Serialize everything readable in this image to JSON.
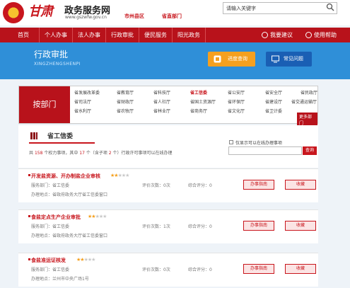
{
  "header": {
    "logo_text": "甘肃",
    "site_name": "政务服务网",
    "site_url": "www.gszwfw.gov.cn",
    "region_label": "市州县区",
    "region_label2": "省直部门",
    "search_placeholder": "请输入关键字"
  },
  "nav": {
    "items": [
      "首页",
      "个人办事",
      "法人办事",
      "行政审批",
      "便民服务",
      "阳光政务"
    ],
    "suggest": "我要建议",
    "help": "使用帮助"
  },
  "banner": {
    "title": "行政审批",
    "subtitle": "XINGZHENGSHENPI",
    "progress_btn": "进度查询",
    "faq_btn": "常见问题"
  },
  "departments": {
    "label": "按部门",
    "rows": [
      [
        "省发展改革委",
        "省教育厅",
        "省科技厅",
        "省工信委",
        "省公安厅",
        "省安全厅",
        "省民政厅"
      ],
      [
        "省司法厅",
        "省财政厅",
        "省人社厅",
        "省国土资源厅",
        "省环保厅",
        "省建设厅",
        "省交通运输厅"
      ],
      [
        "省水利厅",
        "省农牧厅",
        "省林业厅",
        "省商务厅",
        "省文化厅",
        "省卫计委",
        ""
      ]
    ],
    "active": "省工信委",
    "more": "更多部门"
  },
  "section": {
    "title": "省工信委",
    "only_online_label": "仅显示可以在线办理事项",
    "filter_btn": "查询",
    "summary_parts": [
      "共",
      "158",
      "个权力事项，其中",
      "17",
      "个（含子项",
      "2",
      "个）行政许可事项可以在线办理"
    ]
  },
  "items": [
    {
      "title": "开发盐资源、开办制盐企业审核",
      "stars_on": 2,
      "stars_total": 5,
      "subject_label": "服务部门：",
      "subject": "省工信委",
      "address_label": "办理地点：",
      "address": "省政府政务大厅省工信委窗口",
      "rating_count_label": "评价次数：",
      "rating_count": "0次",
      "score_label": "综合评分：",
      "score": "0",
      "guide_btn": "办事指南",
      "fav_btn": "收藏"
    },
    {
      "title": "食盐定点生产企业审批",
      "stars_on": 2,
      "stars_total": 5,
      "subject_label": "服务部门：",
      "subject": "省工信委",
      "address_label": "办理地点：",
      "address": "省政府政务大厅省工信委窗口",
      "rating_count_label": "评价次数：",
      "rating_count": "1次",
      "score_label": "综合评分：",
      "score": "0",
      "guide_btn": "办事指南",
      "fav_btn": "收藏"
    },
    {
      "title": "食盐准运证核发",
      "stars_on": 2,
      "stars_total": 5,
      "subject_label": "服务部门：",
      "subject": "省工信委",
      "address_label": "办理地点：",
      "address": "兰州市中央广场1号",
      "rating_count_label": "评价次数：",
      "rating_count": "0次",
      "score_label": "综合评分：",
      "score": "0",
      "guide_btn": "办事指南",
      "fav_btn": "收藏"
    }
  ],
  "colors": {
    "brand_red": "#b8121b",
    "banner_blue": "#2f8fd8",
    "star": "#f5a01f",
    "progress_orange": "#f5a01f",
    "faq_blue": "#1a5fb4"
  }
}
